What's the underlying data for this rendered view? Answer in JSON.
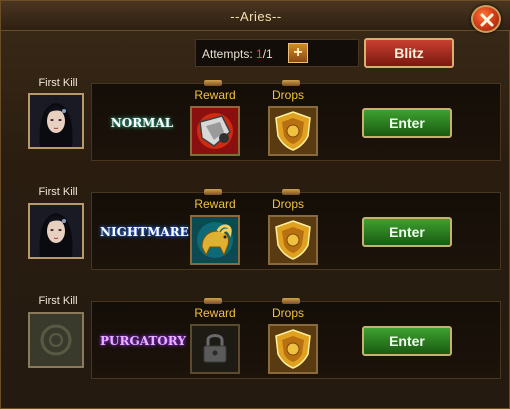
{
  "window": {
    "title": "--Aries--"
  },
  "attempts": {
    "label": "Attempts: ",
    "used": "1",
    "total": "/1",
    "add_symbol": "+"
  },
  "blitz": {
    "label": "Blitz"
  },
  "stages": [
    {
      "first_kill_label": "First Kill",
      "first_kill_avatar": "heroine-portrait",
      "difficulty": "NORMAL",
      "difficulty_color": "#ffffff",
      "reward_label": "Reward",
      "reward_icon": "armor-gauntlet-icon",
      "drops_label": "Drops",
      "drops_icon": "gold-shield-icon",
      "enter_label": "Enter"
    },
    {
      "first_kill_label": "First Kill",
      "first_kill_avatar": "heroine-portrait",
      "difficulty": "NIGHTMARE",
      "difficulty_color": "#ffffff",
      "reward_label": "Reward",
      "reward_icon": "gold-ram-icon",
      "drops_label": "Drops",
      "drops_icon": "gold-shield-icon",
      "enter_label": "Enter"
    },
    {
      "first_kill_label": "First Kill",
      "first_kill_avatar": "locked-slot",
      "difficulty": "PURGATORY",
      "difficulty_color": "#e8b0ff",
      "reward_label": "Reward",
      "reward_icon": "padlock-icon",
      "drops_label": "Drops",
      "drops_icon": "gold-shield-icon",
      "enter_label": "Enter"
    }
  ]
}
